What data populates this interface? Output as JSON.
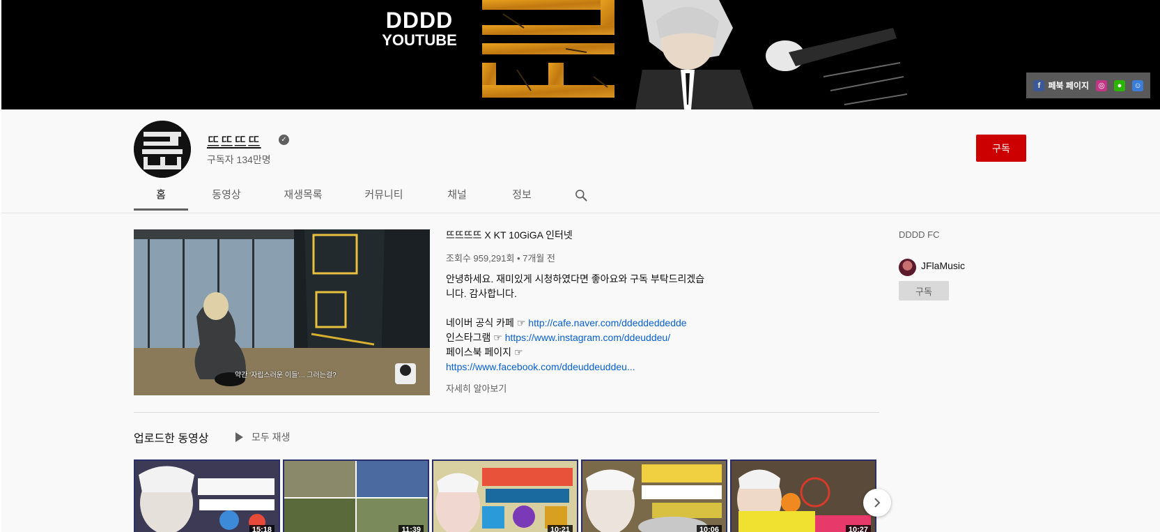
{
  "banner": {
    "brand_line1": "DDDD",
    "brand_line2": "YOUTUBE",
    "links": {
      "facebook_label": "페북 페이지",
      "icons": [
        "facebook-icon",
        "instagram-icon",
        "kakao-icon",
        "cafe-icon"
      ]
    }
  },
  "header": {
    "channel_name": "뜨뜨뜨뜨",
    "verified_icon": "verified-check-icon",
    "subscriber_count": "구독자 134만명",
    "subscribe_label": "구독",
    "tabs": [
      {
        "label": "홈",
        "active": true
      },
      {
        "label": "동영상"
      },
      {
        "label": "재생목록"
      },
      {
        "label": "커뮤니티"
      },
      {
        "label": "채널"
      },
      {
        "label": "정보"
      }
    ],
    "search_icon": "search-icon"
  },
  "featured": {
    "title": "뜨뜨뜨뜨 X KT 10GiGA 인터넷",
    "meta": "조회수 959,291회 • 7개월 전",
    "caption": "약간 '자립스러운 이들'... 그러는걸?",
    "desc_line1": "안녕하세요. 재미있게 시청하였다면 좋아요와 구독 부탁드리겠습",
    "desc_line2": "니다. 감사합니다.",
    "naver_label": "네이버 공식 카페 ☞ ",
    "naver_url": "http://cafe.naver.com/ddeddeddedde",
    "insta_label": "인스타그램 ☞ ",
    "insta_url": "https://www.instagram.com/ddeuddeu/",
    "fb_label": "페이스북 페이지 ☞",
    "fb_url": "https://www.facebook.com/ddeuddeuddeu...",
    "more_label": "자세히 알아보기"
  },
  "uploads": {
    "title": "업로드한 동영상",
    "play_all": "모두 재생",
    "videos": [
      {
        "duration": "15:18"
      },
      {
        "duration": "11:39"
      },
      {
        "duration": "10:21"
      },
      {
        "duration": "10:06"
      },
      {
        "duration": "10:27"
      }
    ]
  },
  "side": {
    "title": "DDDD FC",
    "channel_name": "JFlaMusic",
    "subscribe_label": "구독"
  },
  "colors": {
    "subscribe_red": "#cc0000",
    "link_blue": "#065fd4",
    "background": "#f9f9f9"
  }
}
